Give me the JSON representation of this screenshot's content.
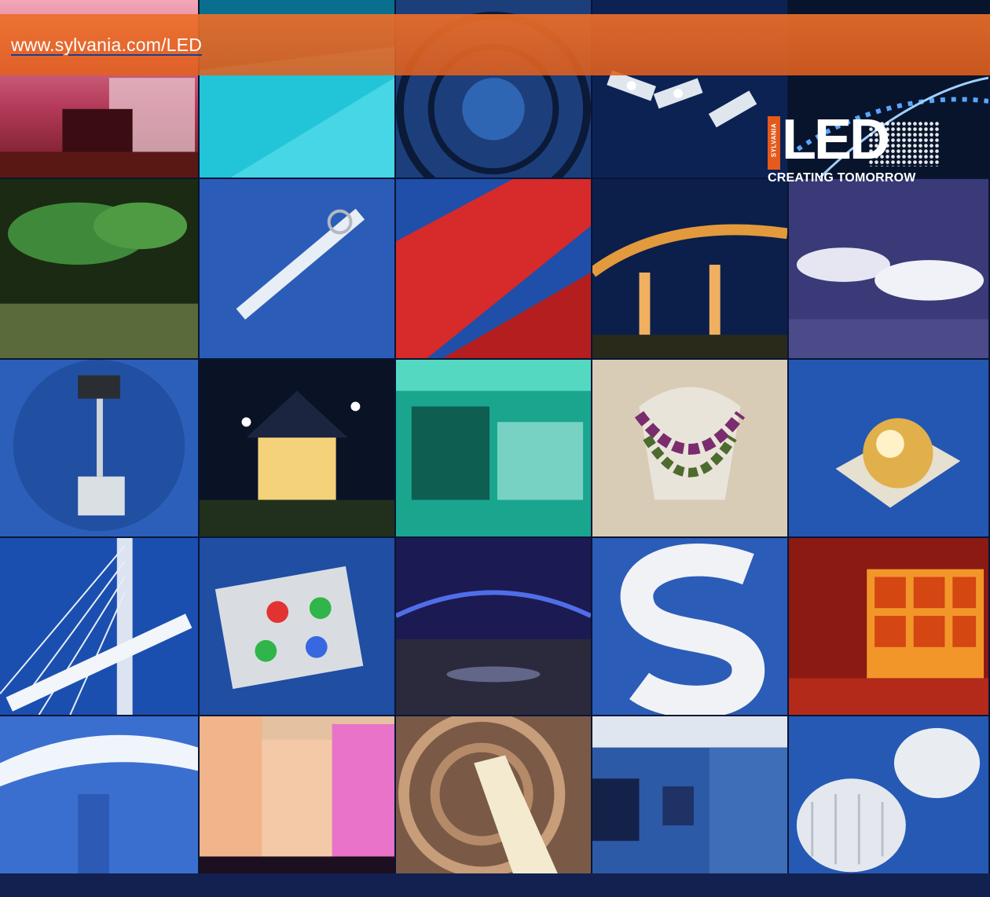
{
  "banner": {
    "url": "www.sylvania.com/LED",
    "color": "#e8682a"
  },
  "logo": {
    "brand": "SYLVANIA",
    "word": "LED",
    "tagline": "CREATING TOMORROW"
  },
  "photos": [
    "retail-store-pink-lighting",
    "cyan-lit-staircase",
    "spiral-staircase-night",
    "led-module-chain",
    "lit-walkway-night",
    "green-canopy-walkway",
    "led-strip-with-ring",
    "red-channel-letters",
    "illuminated-bridge-night",
    "banquet-hall-tables",
    "led-high-bay-fixture",
    "building-at-night-with-lamps",
    "green-lit-lobby",
    "jewelry-necklace-display",
    "led-chip-closeup",
    "cable-stayed-bridge",
    "rgb-led-boards",
    "blue-lit-tunnel-hall",
    "channel-letter-s-modules",
    "red-orange-lounge",
    "white-curved-architecture",
    "colored-building-facade",
    "spiral-atrium-downlights",
    "hallway-with-downlights",
    "led-heat-sink-lamps"
  ]
}
